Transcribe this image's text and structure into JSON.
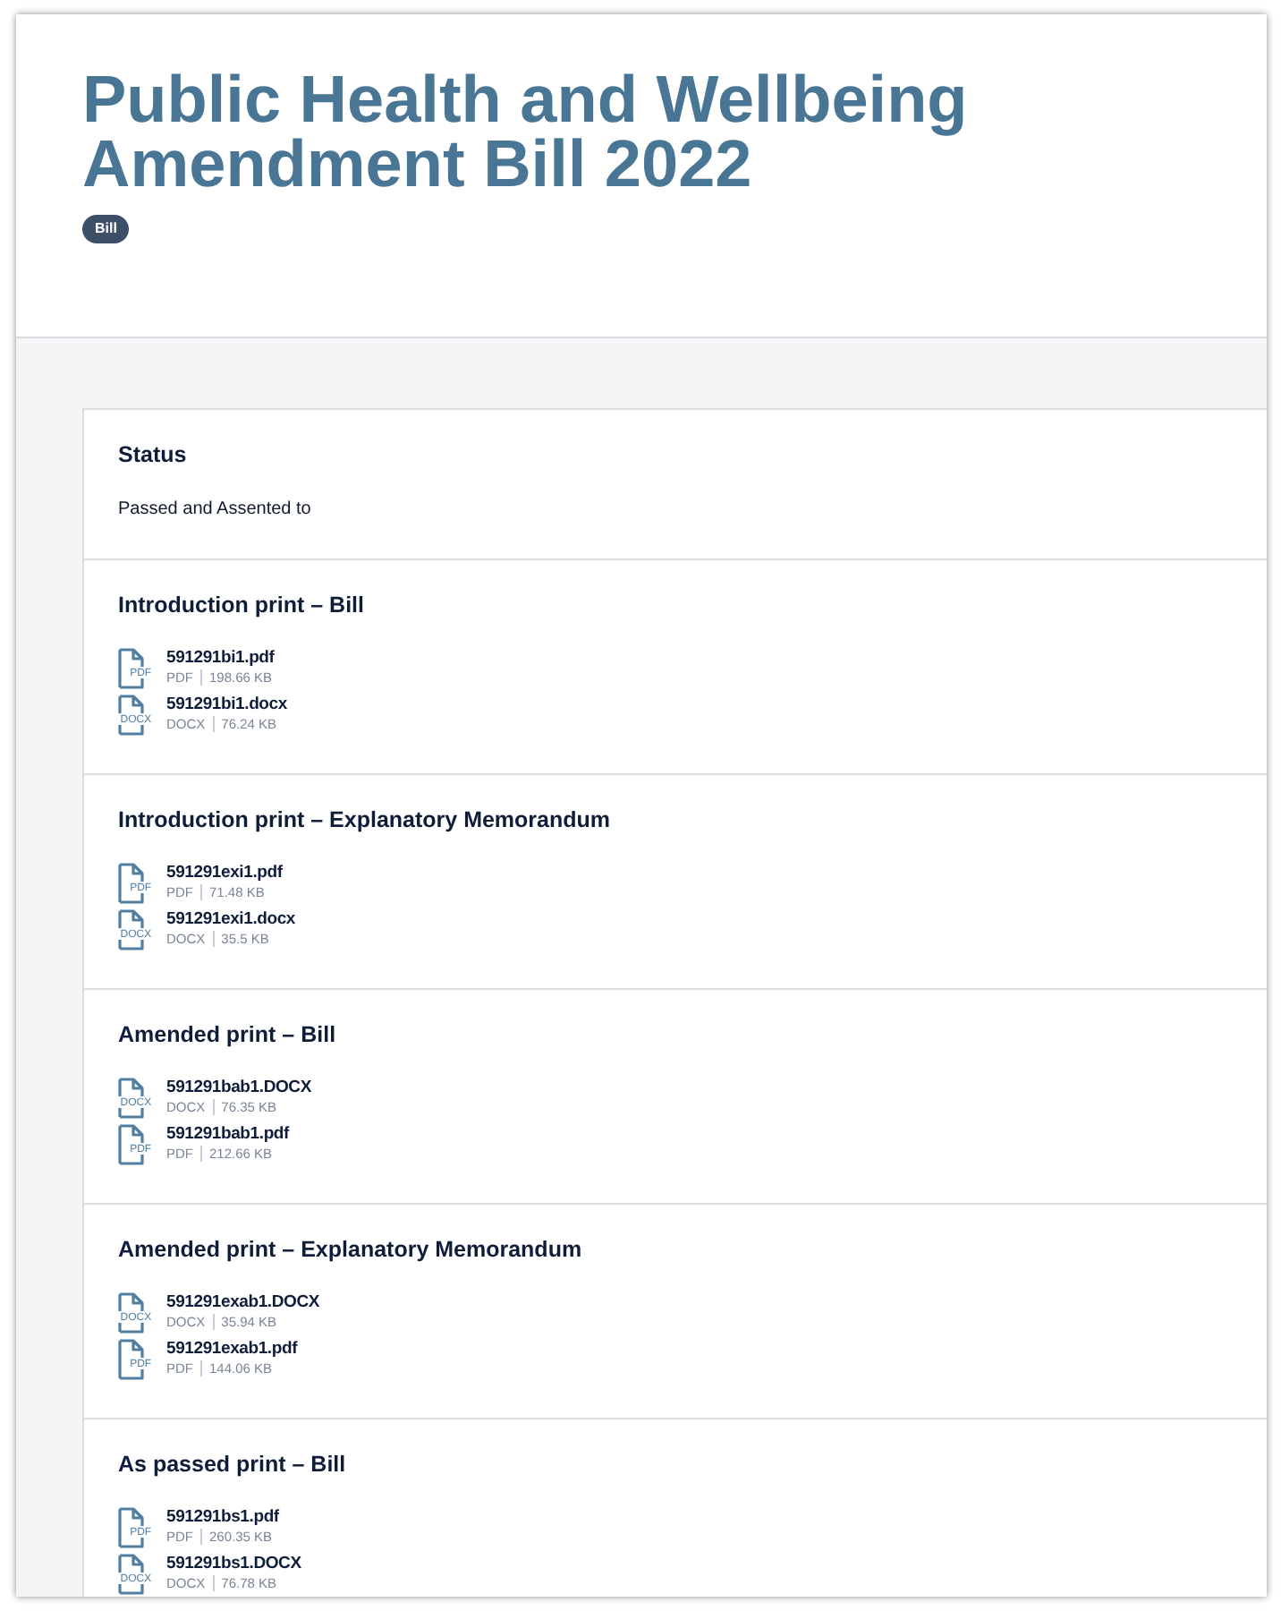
{
  "header": {
    "title": "Public Health and Wellbeing Amendment Bill 2022",
    "badge": "Bill"
  },
  "status": {
    "heading": "Status",
    "value": "Passed and Assented to"
  },
  "documents": [
    {
      "heading": "Introduction print – Bill",
      "files": [
        {
          "name": "591291bi1.pdf",
          "icon_label": "PDF",
          "type": "PDF",
          "size": "198.66 KB"
        },
        {
          "name": "591291bi1.docx",
          "icon_label": "DOCX",
          "type": "DOCX",
          "size": "76.24 KB"
        }
      ]
    },
    {
      "heading": "Introduction print – Explanatory Memorandum",
      "files": [
        {
          "name": "591291exi1.pdf",
          "icon_label": "PDF",
          "type": "PDF",
          "size": "71.48 KB"
        },
        {
          "name": "591291exi1.docx",
          "icon_label": "DOCX",
          "type": "DOCX",
          "size": "35.5 KB"
        }
      ]
    },
    {
      "heading": "Amended print – Bill",
      "files": [
        {
          "name": "591291bab1.DOCX",
          "icon_label": "DOCX",
          "type": "DOCX",
          "size": "76.35 KB"
        },
        {
          "name": "591291bab1.pdf",
          "icon_label": "PDF",
          "type": "PDF",
          "size": "212.66 KB"
        }
      ]
    },
    {
      "heading": "Amended print – Explanatory Memorandum",
      "files": [
        {
          "name": "591291exab1.DOCX",
          "icon_label": "DOCX",
          "type": "DOCX",
          "size": "35.94 KB"
        },
        {
          "name": "591291exab1.pdf",
          "icon_label": "PDF",
          "type": "PDF",
          "size": "144.06 KB"
        }
      ]
    },
    {
      "heading": "As passed print – Bill",
      "files": [
        {
          "name": "591291bs1.pdf",
          "icon_label": "PDF",
          "type": "PDF",
          "size": "260.35 KB"
        },
        {
          "name": "591291bs1.DOCX",
          "icon_label": "DOCX",
          "type": "DOCX",
          "size": "76.78 KB"
        }
      ]
    }
  ]
}
